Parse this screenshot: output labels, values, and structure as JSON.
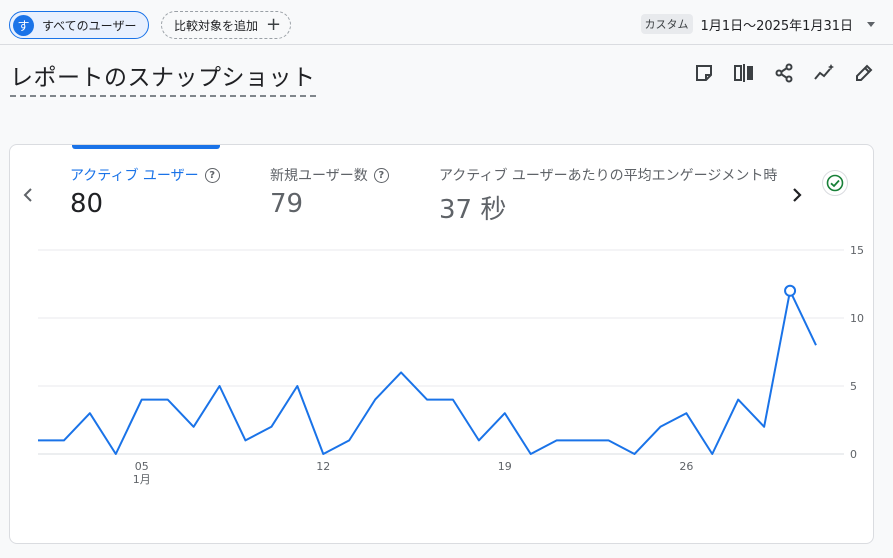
{
  "segment": {
    "avatar_letter": "す",
    "label": "すべてのユーザー"
  },
  "compare": {
    "label": "比較対象を追加",
    "icon": "plus-icon"
  },
  "date": {
    "badge": "カスタム",
    "range": "1月1日～2025年1月31日"
  },
  "title": "レポートのスナップショット",
  "toolbar_icons": [
    "note-icon",
    "compare-columns-icon",
    "share-icon",
    "insights-icon",
    "edit-icon"
  ],
  "metrics": [
    {
      "label": "アクティブ ユーザー",
      "value": "80",
      "active": true
    },
    {
      "label": "新規ユーザー数",
      "value": "79",
      "active": false
    },
    {
      "label": "アクティブ ユーザーあたりの平均エンゲージメント時",
      "value": "37 秒",
      "active": false
    }
  ],
  "colors": {
    "accent": "#1a73e8",
    "success": "#188038"
  },
  "chart_data": {
    "type": "line",
    "x": [
      1,
      2,
      3,
      4,
      5,
      6,
      7,
      8,
      9,
      10,
      11,
      12,
      13,
      14,
      15,
      16,
      17,
      18,
      19,
      20,
      21,
      22,
      23,
      24,
      25,
      26,
      27,
      28,
      29,
      30,
      31
    ],
    "x_tick_values": [
      5,
      12,
      19,
      26
    ],
    "x_tick_labels": [
      "05",
      "12",
      "19",
      "26"
    ],
    "x_sublabel": "1月",
    "series": [
      {
        "values": [
          1,
          1,
          3,
          0,
          4,
          4,
          2,
          5,
          1,
          2,
          5,
          0,
          1,
          4,
          6,
          4,
          4,
          1,
          3,
          0,
          1,
          1,
          1,
          0,
          2,
          3,
          0,
          4,
          2,
          12,
          8
        ]
      }
    ],
    "ylim": [
      0,
      15
    ],
    "y_ticks": [
      0,
      5,
      10,
      15
    ],
    "highlight_index": 29,
    "grid": true
  }
}
